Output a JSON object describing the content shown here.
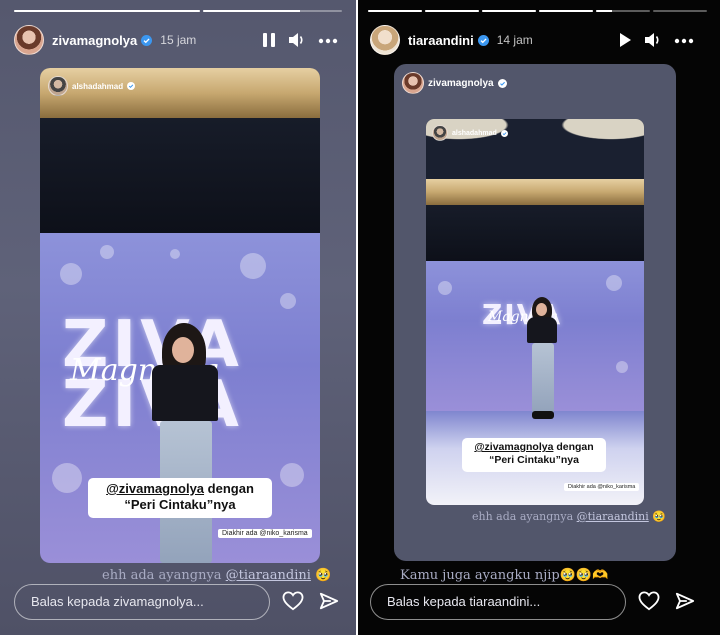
{
  "left_story": {
    "username": "zivamagnolya",
    "time": "15 jam",
    "progress": {
      "segments": 2,
      "fill": [
        1,
        0.7
      ]
    },
    "inner": {
      "username": "alshadahmad",
      "stage_title": "ZIVA",
      "stage_script": "Magnolya",
      "sticker_mention": "@zivamagnolya",
      "sticker_rest": " dengan",
      "sticker_line2": "“Peri Cintaku”nya",
      "credit": "Diakhir ada @niko_karisma"
    },
    "caption_text": "ehh ada ayangnya ",
    "caption_mention": "@tiaraandini",
    "caption_emoji": "🥹",
    "reply_placeholder": "Balas kepada zivamagnolya..."
  },
  "right_story": {
    "username": "tiaraandini",
    "time": "14 jam",
    "progress": {
      "segments": 6,
      "fill": [
        1,
        1,
        1,
        1,
        0.3,
        0
      ]
    },
    "shared": {
      "username": "zivamagnolya",
      "inner_username": "alshadahmad",
      "stage_title": "ZIVA",
      "stage_script": "Magnolya",
      "sticker_mention": "@zivamagnolya",
      "sticker_rest": " dengan",
      "sticker_line2": "“Peri Cintaku”nya",
      "credit": "Diakhir ada @niko_karisma",
      "caption_text": "ehh ada ayangnya ",
      "caption_mention": "@tiaraandini",
      "caption_emoji": "🥹"
    },
    "caption_text": "Kamu juga ayangku njip",
    "caption_emoji": "🥹🥹🫶",
    "reply_placeholder": "Balas kepada tiaraandini..."
  },
  "icons": {
    "pause": "pause-icon",
    "play": "play-icon",
    "volume": "volume-icon",
    "more": "more-icon",
    "heart": "heart-icon",
    "send": "send-icon",
    "verified": "verified-badge-icon"
  }
}
